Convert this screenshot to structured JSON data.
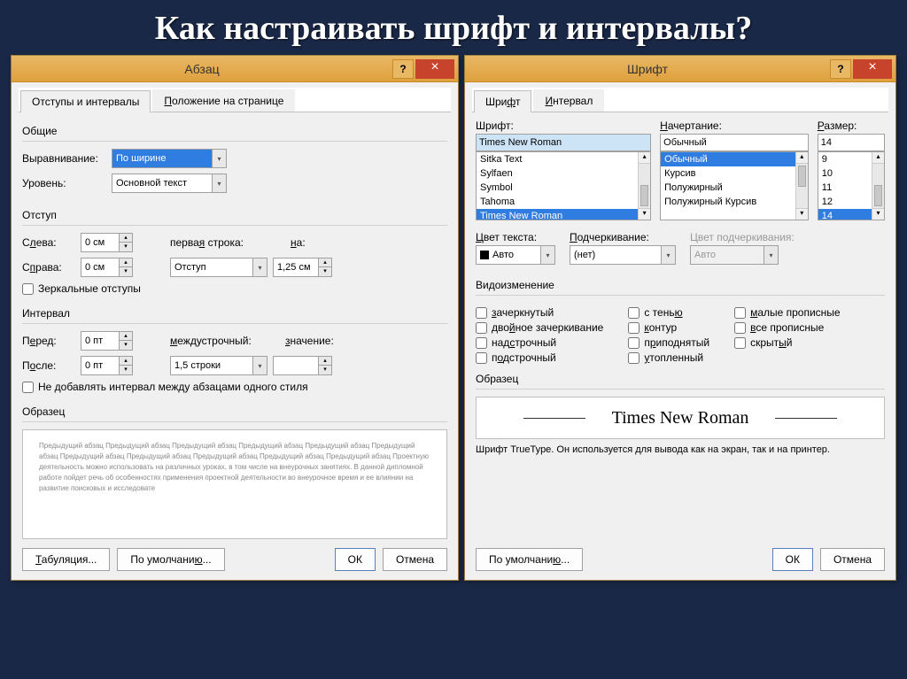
{
  "slide_title": "Как настраивать шрифт и интервалы?",
  "paragraph": {
    "title": "Абзац",
    "tabs": {
      "indent": "Отступы и интервалы",
      "position": "Положение на странице"
    },
    "general": {
      "label": "Общие",
      "alignment_label": "Выравнивание:",
      "alignment_value": "По ширине",
      "level_label": "Уровень:",
      "level_value": "Основной текст"
    },
    "indent": {
      "label": "Отступ",
      "left_label": "Слева:",
      "left_value": "0 см",
      "right_label": "Справа:",
      "right_value": "0 см",
      "first_line_label": "первая строка:",
      "first_line_value": "Отступ",
      "by_label": "на:",
      "by_value": "1,25 см",
      "mirror": "Зеркальные отступы"
    },
    "spacing": {
      "label": "Интервал",
      "before_label": "Перед:",
      "before_value": "0 пт",
      "after_label": "После:",
      "after_value": "0 пт",
      "line_label": "междустрочный:",
      "line_value": "1,5 строки",
      "at_label": "значение:",
      "same_style": "Не добавлять интервал между абзацами одного стиля"
    },
    "sample_label": "Образец",
    "preview_text": "Предыдущий абзац Предыдущий абзац Предыдущий абзац Предыдущий абзац Предыдущий абзац Предыдущий абзац Предыдущий абзац Предыдущий абзац Предыдущий абзац Предыдущий абзац Предыдущий абзац\n      Проектную деятельность можно использовать на различных уроках, в том числе на внеурочных занятиях. В данной дипломной работе пойдет речь об особенностях применения проектной деятельности во внеурочное время и ее влиянии на развитие поисковых и исследовате",
    "buttons": {
      "tabs": "Табуляция...",
      "default": "По умолчанию...",
      "ok": "ОК",
      "cancel": "Отмена"
    }
  },
  "font": {
    "title": "Шрифт",
    "tabs": {
      "font": "Шрифт",
      "advanced": "Интервал"
    },
    "font_label": "Шрифт:",
    "font_value": "Times New Roman",
    "font_list": [
      "Sitka Text",
      "Sylfaen",
      "Symbol",
      "Tahoma",
      "Times New Roman"
    ],
    "style_label": "Начертание:",
    "style_value": "Обычный",
    "style_list": [
      "Обычный",
      "Курсив",
      "Полужирный",
      "Полужирный Курсив"
    ],
    "size_label": "Размер:",
    "size_value": "14",
    "size_list": [
      "9",
      "10",
      "11",
      "12",
      "14"
    ],
    "color_label": "Цвет текста:",
    "color_value": "Авто",
    "underline_label": "Подчеркивание:",
    "underline_value": "(нет)",
    "underline_color_label": "Цвет подчеркивания:",
    "underline_color_value": "Авто",
    "effects_label": "Видоизменение",
    "effects": {
      "col1": [
        "зачеркнутый",
        "двойное зачеркивание",
        "надстрочный",
        "подстрочный"
      ],
      "col2": [
        "с тенью",
        "контур",
        "приподнятый",
        "утопленный"
      ],
      "col3": [
        "малые прописные",
        "все прописные",
        "скрытый"
      ]
    },
    "sample_label": "Образец",
    "sample_text": "Times New Roman",
    "truetype_text": "Шрифт TrueType. Он используется для вывода как на экран, так и на принтер.",
    "buttons": {
      "default": "По умолчанию...",
      "ok": "ОК",
      "cancel": "Отмена"
    }
  }
}
